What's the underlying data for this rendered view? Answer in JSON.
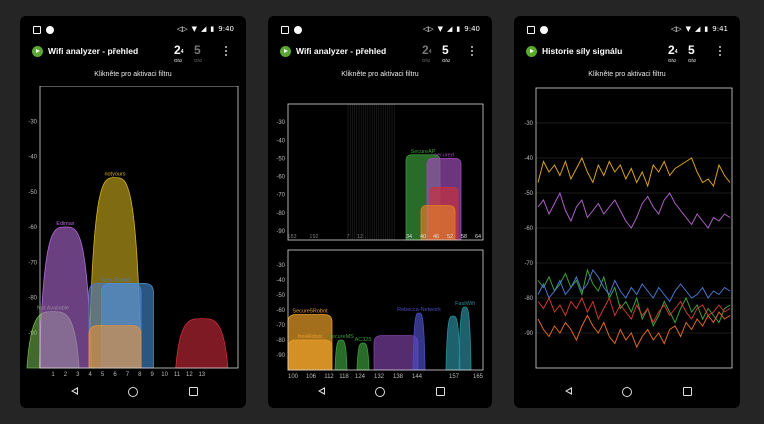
{
  "phones": [
    {
      "time": "9:40",
      "title": "Wifi analyzer - přehled",
      "band_24": "2",
      "band_24_sub": "Ghz",
      "band_24_small": "4",
      "band_5": "5",
      "band_5_sub": "Ghz",
      "active_band": "2.4",
      "filter_hint": "Klikněte pro aktivaci filtru"
    },
    {
      "time": "9:40",
      "title": "Wifi analyzer - přehled",
      "band_24": "2",
      "band_24_sub": "Ghz",
      "band_24_small": "4",
      "band_5": "5",
      "band_5_sub": "Ghz",
      "active_band": "5",
      "filter_hint": "Klikněte pro aktivaci filtru"
    },
    {
      "time": "9:41",
      "title": "Historie síly signálu",
      "band_24": "2",
      "band_24_sub": "Ghz",
      "band_24_small": "4",
      "band_5": "5",
      "band_5_sub": "Ghz",
      "active_band": "2.4",
      "filter_hint": "Klikněte pro aktivaci filtru"
    }
  ],
  "chart_data": [
    {
      "type": "area",
      "ylim": [
        -100,
        -20
      ],
      "yticks": [
        "-30",
        "-40",
        "-50",
        "-60",
        "-70",
        "-80",
        "-90"
      ],
      "xticks": [
        "1",
        "2",
        "3",
        "4",
        "5",
        "6",
        "7",
        "8",
        "9",
        "10",
        "11",
        "12",
        "13"
      ],
      "networks": [
        {
          "name": "Not Available",
          "center": 1,
          "width": 4,
          "level": -84,
          "color": "#6fb04a"
        },
        {
          "name": "Edimax",
          "center": 2,
          "width": 4,
          "level": -60,
          "color": "#b36bd6"
        },
        {
          "name": "notyours",
          "center": 6,
          "width": 4,
          "level": -46,
          "color": "#d4b21e"
        },
        {
          "name": "Tuev-Sound",
          "center": 6,
          "width": 4,
          "level": -76,
          "color": "#4f79c4"
        },
        {
          "name": "",
          "center": 7,
          "width": 4,
          "level": -76,
          "color": "#4a8fd8"
        },
        {
          "name": "",
          "center": 6,
          "width": 4,
          "level": -88,
          "color": "#e8913a"
        },
        {
          "name": "",
          "center": 13,
          "width": 4,
          "level": -86,
          "color": "#d02c3c"
        }
      ]
    },
    {
      "type": "area",
      "upper": {
        "ylim": [
          -95,
          -20
        ],
        "yticks": [
          "-30",
          "-40",
          "-50",
          "-60",
          "-70",
          "-80",
          "-90"
        ],
        "xticks": [
          "183",
          "192",
          "7",
          "12",
          "34",
          "40",
          "46",
          "52",
          "58",
          "64"
        ],
        "networks": [
          {
            "name": "SecureAP",
            "level": -48,
            "color": "#3a9a3a"
          },
          {
            "name": "secured",
            "level": -50,
            "color": "#9a4bb4"
          },
          {
            "name": "",
            "level": -66,
            "color": "#c8323e"
          },
          {
            "name": "",
            "level": -76,
            "color": "#e07b2a"
          }
        ]
      },
      "lower": {
        "ylim": [
          -100,
          -20
        ],
        "yticks": [
          "-30",
          "-40",
          "-50",
          "-60",
          "-70",
          "-80",
          "-90"
        ],
        "xticks": [
          "100",
          "106",
          "112",
          "118",
          "124",
          "132",
          "138",
          "144",
          "157",
          "165"
        ],
        "networks": [
          {
            "name": "Secure5Robot",
            "level": -63,
            "color": "#e89e2a"
          },
          {
            "name": "freeRobot",
            "level": -80,
            "color": "#e89e2a"
          },
          {
            "name": "SecureMS",
            "level": -80,
            "color": "#3a9a3a"
          },
          {
            "name": "AC325",
            "level": -82,
            "color": "#3a9a3a"
          },
          {
            "name": "",
            "level": -77,
            "color": "#7b3fa0"
          },
          {
            "name": "Rebecca-Network",
            "level": -62,
            "color": "#4b4bc0"
          },
          {
            "name": "",
            "level": -64,
            "color": "#2a8a9a"
          },
          {
            "name": "FastWifi",
            "level": -58,
            "color": "#2a8a9a"
          }
        ]
      }
    },
    {
      "type": "line",
      "ylim": [
        -100,
        -20
      ],
      "yticks": [
        "-30",
        "-40",
        "-50",
        "-60",
        "-70",
        "-80",
        "-90"
      ],
      "series": [
        {
          "color": "#d9a21e",
          "values": [
            -47,
            -41,
            -44,
            -42,
            -45,
            -41,
            -46,
            -43,
            -40,
            -44,
            -47,
            -42,
            -45,
            -41,
            -44,
            -42,
            -46,
            -43,
            -47,
            -44,
            -48,
            -42,
            -44,
            -41,
            -45,
            -43,
            -42,
            -41,
            -40,
            -44,
            -47,
            -46,
            -48,
            -42,
            -45,
            -47
          ]
        },
        {
          "color": "#b060c8",
          "values": [
            -54,
            -52,
            -56,
            -53,
            -50,
            -55,
            -58,
            -54,
            -52,
            -57,
            -55,
            -53,
            -56,
            -54,
            -52,
            -55,
            -58,
            -60,
            -57,
            -53,
            -51,
            -54,
            -56,
            -52,
            -50,
            -53,
            -55,
            -57,
            -59,
            -56,
            -58,
            -60,
            -57,
            -58,
            -56,
            -57
          ]
        },
        {
          "color": "#3ca03c",
          "values": [
            -75,
            -77,
            -74,
            -78,
            -76,
            -73,
            -77,
            -75,
            -79,
            -72,
            -76,
            -78,
            -74,
            -80,
            -77,
            -83,
            -81,
            -84,
            -80,
            -86,
            -83,
            -88,
            -85,
            -81,
            -84,
            -87,
            -83,
            -80,
            -84,
            -82,
            -86,
            -83,
            -85,
            -87,
            -83,
            -82
          ]
        },
        {
          "color": "#4a78d0",
          "values": [
            -79,
            -76,
            -80,
            -78,
            -75,
            -79,
            -77,
            -74,
            -78,
            -76,
            -72,
            -74,
            -77,
            -79,
            -75,
            -78,
            -80,
            -77,
            -79,
            -76,
            -78,
            -80,
            -77,
            -79,
            -81,
            -78,
            -76,
            -78,
            -80,
            -79,
            -77,
            -80,
            -78,
            -79,
            -77,
            -78
          ]
        },
        {
          "color": "#cc3a2e",
          "values": [
            -81,
            -83,
            -80,
            -84,
            -82,
            -85,
            -81,
            -83,
            -80,
            -84,
            -81,
            -86,
            -83,
            -80,
            -85,
            -82,
            -84,
            -86,
            -82,
            -85,
            -83,
            -87,
            -84,
            -82,
            -85,
            -83,
            -81,
            -84,
            -86,
            -83,
            -82,
            -85,
            -84,
            -82,
            -84,
            -83
          ]
        },
        {
          "color": "#e06a20",
          "values": [
            -86,
            -89,
            -91,
            -88,
            -90,
            -87,
            -89,
            -92,
            -88,
            -85,
            -88,
            -90,
            -87,
            -91,
            -93,
            -89,
            -92,
            -90,
            -94,
            -91,
            -89,
            -92,
            -90,
            -93,
            -89,
            -88,
            -91,
            -87,
            -89,
            -86,
            -88,
            -85,
            -87,
            -84,
            -86,
            -85
          ]
        }
      ]
    }
  ]
}
